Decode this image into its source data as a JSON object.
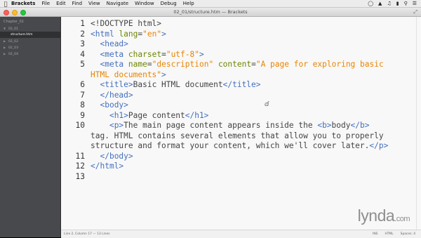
{
  "menubar": {
    "apple_icon": "apple-icon",
    "app_name": "Brackets",
    "items": [
      "File",
      "Edit",
      "Find",
      "View",
      "Navigate",
      "Window",
      "Debug",
      "Help"
    ]
  },
  "window": {
    "title": "02_01/structure.htm — Brackets"
  },
  "sidebar": {
    "project_name": "Chapter_02",
    "tree": [
      {
        "label": "02_01",
        "type": "folder",
        "expanded": true,
        "selected": false
      },
      {
        "label": "structure.htm",
        "type": "file",
        "expanded": false,
        "selected": true
      },
      {
        "label": "02_02",
        "type": "folder",
        "expanded": false,
        "selected": false
      },
      {
        "label": "02_03",
        "type": "folder",
        "expanded": false,
        "selected": false
      },
      {
        "label": "02_04",
        "type": "folder",
        "expanded": false,
        "selected": false
      }
    ]
  },
  "editor": {
    "line_numbers": [
      "1",
      "2",
      "3",
      "4",
      "5",
      "6",
      "7",
      "8",
      "9",
      "10",
      "11",
      "12",
      "13"
    ]
  },
  "statusbar": {
    "cursor_position": "Line 2, Column 17 — 13 Lines",
    "encoding": "INS",
    "language": "HTML",
    "indent": "Spaces: 4"
  },
  "watermark": {
    "brand": "lynda",
    "domain": ".com"
  },
  "colors": {
    "tag": "#446fbd",
    "attribute": "#6d8600",
    "value": "#e88501",
    "text": "#444444",
    "sidebar_bg": "#47494c",
    "editor_bg": "#f8f8f8"
  }
}
